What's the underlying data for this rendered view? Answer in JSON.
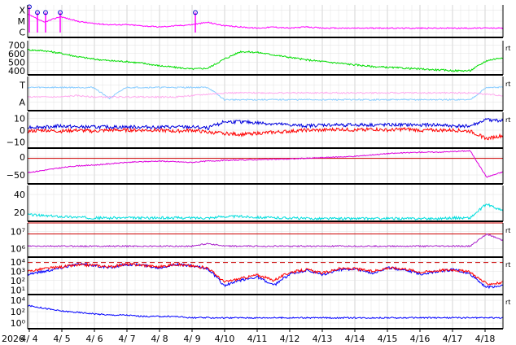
{
  "chart_data": [
    {
      "type": "line",
      "panel": "xray-flares",
      "y_tick_labels": [
        "X",
        "M",
        "C"
      ],
      "series": [
        {
          "color": "#ff00ff",
          "values": [
            1.6,
            0.9,
            1.4,
            1.0,
            0.8,
            0.7,
            0.7,
            0.6,
            0.5,
            0.6,
            0.7,
            0.9,
            0.6,
            0.5,
            0.4,
            0.5,
            0.4,
            0.5,
            0.4,
            0.4,
            0.4,
            0.4,
            0.4,
            0.4,
            0.4,
            0.4,
            0.4,
            0.4,
            0.4,
            0.4
          ]
        }
      ],
      "flare_markers": [
        {
          "day": 4.0,
          "level": 3.2
        },
        {
          "day": 4.25,
          "level": 2.6
        },
        {
          "day": 4.5,
          "level": 2.6
        },
        {
          "day": 4.95,
          "level": 2.6
        },
        {
          "day": 9.1,
          "level": 2.6
        }
      ]
    },
    {
      "type": "line",
      "panel": "solar-wind-speed",
      "y_tick_labels": [
        "700",
        "600",
        "500",
        "400"
      ],
      "ylim": [
        330,
        740
      ],
      "series": [
        {
          "color": "#00dd00",
          "values": [
            630,
            620,
            590,
            550,
            520,
            500,
            490,
            470,
            440,
            420,
            400,
            410,
            520,
            610,
            600,
            570,
            540,
            510,
            490,
            470,
            450,
            430,
            420,
            410,
            400,
            390,
            380,
            380,
            500,
            540
          ]
        }
      ]
    },
    {
      "type": "line",
      "panel": "particle-tracks",
      "y_tick_labels": [
        "T",
        "A"
      ],
      "series": [
        {
          "color": "#88ccff",
          "values": [
            1,
            1,
            1,
            1,
            1,
            0.2,
            1,
            1,
            1,
            1,
            1,
            1,
            0.1,
            0.1,
            0.1,
            0.1,
            0.1,
            0.1,
            0.1,
            0.1,
            0.1,
            0.1,
            0.1,
            0.1,
            0.1,
            0.1,
            0.1,
            0.1,
            1,
            1
          ]
        },
        {
          "color": "#ffaaee",
          "values": [
            0.3,
            0.3,
            0.3,
            0.4,
            0.3,
            0.3,
            0.3,
            0.3,
            0.3,
            0.3,
            0.4,
            0.5,
            0.6,
            0.6,
            0.6,
            0.6,
            0.6,
            0.6,
            0.6,
            0.6,
            0.6,
            0.6,
            0.6,
            0.6,
            0.6,
            0.6,
            0.6,
            0.6,
            0.5,
            0.4
          ]
        }
      ]
    },
    {
      "type": "line",
      "panel": "imf-field",
      "y_tick_labels": [
        "10",
        "0",
        "−10"
      ],
      "ylim": [
        -17,
        17
      ],
      "series": [
        {
          "color": "#0000dd",
          "values": [
            3,
            3,
            4,
            3,
            3,
            3,
            3,
            3,
            3,
            3,
            3,
            2,
            8,
            8,
            7,
            6,
            5,
            4,
            5,
            5,
            5,
            5,
            5,
            5,
            5,
            5,
            4,
            4,
            10,
            9
          ]
        },
        {
          "color": "#ff0000",
          "values": [
            -1,
            0,
            -1,
            0,
            -1,
            0,
            0,
            0,
            0,
            -1,
            0,
            -2,
            -3,
            -4,
            -3,
            -2,
            -1,
            0,
            0,
            1,
            0,
            1,
            0,
            1,
            0,
            0,
            0,
            -1,
            -8,
            -5
          ]
        }
      ]
    },
    {
      "type": "line",
      "panel": "dst-index",
      "y_tick_labels": [
        "0",
        "−50"
      ],
      "ylim": [
        -75,
        30
      ],
      "reference_line": 0,
      "series": [
        {
          "color": "#dd00dd",
          "values": [
            -42,
            -35,
            -28,
            -22,
            -20,
            -16,
            -12,
            -10,
            -8,
            -10,
            -12,
            -8,
            -6,
            -5,
            -4,
            -3,
            -2,
            0,
            2,
            4,
            6,
            10,
            14,
            16,
            18,
            18,
            20,
            22,
            -55,
            -40
          ]
        }
      ]
    },
    {
      "type": "line",
      "panel": "electron-flux",
      "y_tick_labels": [
        "40",
        "20"
      ],
      "ylim": [
        0,
        52
      ],
      "series": [
        {
          "color": "#00dddd",
          "values": [
            10,
            8,
            7,
            6,
            5,
            5,
            5,
            5,
            5,
            5,
            5,
            5,
            7,
            7,
            6,
            5,
            5,
            4,
            4,
            4,
            4,
            4,
            4,
            4,
            4,
            4,
            5,
            5,
            25,
            15
          ]
        }
      ]
    },
    {
      "type": "line",
      "panel": "proton-flux",
      "y_tick_labels": [
        "10⁷",
        "10⁶"
      ],
      "reference_lines": [
        7.0,
        6.0
      ],
      "series": [
        {
          "color": "#aa22cc",
          "values": [
            5.1,
            5.1,
            5.1,
            5.1,
            5.1,
            5.1,
            5.1,
            5.1,
            5.1,
            5.1,
            5.1,
            5.3,
            5.1,
            5.1,
            5.1,
            5.1,
            5.1,
            5.1,
            5.1,
            5.1,
            5.1,
            5.1,
            5.1,
            5.1,
            5.1,
            5.1,
            5.1,
            5.1,
            6.0,
            5.5
          ]
        }
      ]
    },
    {
      "type": "line",
      "panel": "high-energy-electrons",
      "y_tick_labels": [
        "10⁴",
        "10³",
        "10²",
        "10¹"
      ],
      "reference_line": 3.8,
      "series": [
        {
          "color": "#0000ff",
          "values": [
            2.5,
            2.8,
            3.2,
            3.6,
            3.5,
            3.2,
            3.6,
            3.5,
            3.2,
            3.6,
            3.4,
            3.1,
            1.2,
            1.8,
            2.2,
            1.2,
            2.5,
            2.9,
            2.4,
            3.0,
            3.1,
            2.6,
            3.2,
            3.0,
            2.5,
            2.8,
            3.0,
            2.5,
            1.0,
            1.2
          ]
        },
        {
          "color": "#ff0000",
          "values": [
            2.8,
            3.1,
            3.3,
            3.5,
            3.5,
            3.3,
            3.6,
            3.5,
            3.3,
            3.6,
            3.4,
            3.2,
            1.6,
            2.0,
            2.4,
            1.8,
            2.7,
            3.0,
            2.6,
            3.1,
            3.1,
            2.8,
            3.2,
            3.1,
            2.7,
            2.9,
            3.0,
            2.7,
            1.4,
            1.5
          ]
        }
      ]
    },
    {
      "type": "line",
      "panel": "low-flux",
      "y_tick_labels": [
        "10⁴",
        "10²",
        "10⁰"
      ],
      "series": [
        {
          "color": "#0000ff",
          "values": [
            0.6,
            0.4,
            0.2,
            0.1,
            0.0,
            -0.1,
            -0.1,
            -0.2,
            -0.2,
            -0.2,
            -0.3,
            -0.3,
            -0.3,
            -0.3,
            -0.3,
            -0.3,
            -0.3,
            -0.3,
            -0.3,
            -0.3,
            -0.3,
            -0.3,
            -0.3,
            -0.3,
            -0.3,
            -0.3,
            -0.3,
            -0.3,
            -0.3,
            -0.3
          ]
        }
      ]
    }
  ],
  "x_axis": {
    "start_label": "2026",
    "tick_labels": [
      "4/ 4",
      "4/ 5",
      "4/ 6",
      "4/ 7",
      "4/ 8",
      "4/ 9",
      "4/10",
      "4/11",
      "4/12",
      "4/13",
      "4/14",
      "4/15",
      "4/16",
      "4/17",
      "4/18"
    ],
    "day_range": [
      3.95,
      18.55
    ]
  },
  "right_marks": [
    "rt",
    "rt",
    "rt",
    "rt",
    "rt",
    "rt"
  ]
}
